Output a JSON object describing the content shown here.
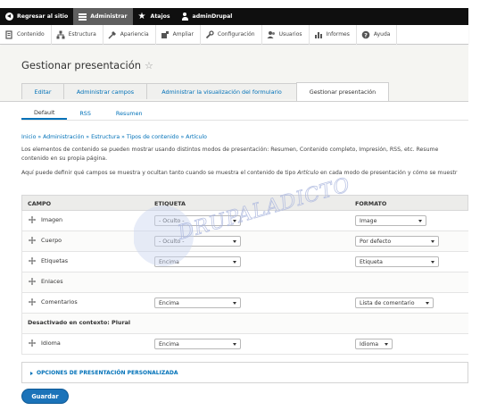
{
  "toolbar": {
    "items": [
      {
        "label": "Regresar al sitio",
        "icon": "back-arrow-icon"
      },
      {
        "label": "Administrar",
        "icon": "menu-icon"
      },
      {
        "label": "Atajos",
        "icon": "star-icon"
      },
      {
        "label": "adminDrupal",
        "icon": "user-icon"
      }
    ]
  },
  "admin_menu": {
    "items": [
      {
        "label": "Contenido",
        "icon": "content-icon"
      },
      {
        "label": "Estructura",
        "icon": "structure-icon"
      },
      {
        "label": "Apariencia",
        "icon": "appearance-icon"
      },
      {
        "label": "Ampliar",
        "icon": "extend-icon"
      },
      {
        "label": "Configuración",
        "icon": "wrench-icon"
      },
      {
        "label": "Usuarios",
        "icon": "users-icon"
      },
      {
        "label": "Informes",
        "icon": "reports-icon"
      },
      {
        "label": "Ayuda",
        "icon": "help-icon"
      }
    ]
  },
  "page": {
    "title": "Gestionar presentación",
    "title_icon": "star-outline-icon",
    "tabs": [
      {
        "label": "Editar"
      },
      {
        "label": "Administrar campos"
      },
      {
        "label": "Administrar la visualización del formulario"
      },
      {
        "label": "Gestionar presentación"
      }
    ],
    "subtabs": [
      {
        "label": "Default"
      },
      {
        "label": "RSS"
      },
      {
        "label": "Resumen"
      }
    ],
    "breadcrumb": "Inicio » Administración » Estructura » Tipos de contenido » Artículo",
    "description_1": "Los elementos de contenido se pueden mostrar usando distintos modos de presentación: Resumen, Contenido completo, Impresión, RSS, etc. Resume",
    "description_2": "contenido en su propia página.",
    "description_3_a": "Aquí puede definir qué campos se muestra y ocultan tanto cuando se muestra el contenido de tipo ",
    "description_3_em": "Artículo",
    "description_3_b": " en cada modo de presentación y cómo se muestr"
  },
  "table": {
    "headers": {
      "field": "CAMPO",
      "label": "ETIQUETA",
      "format": "FORMATO"
    },
    "rows": [
      {
        "name": "Imagen",
        "label": "- Oculto -",
        "format": "Image"
      },
      {
        "name": "Cuerpo",
        "label": "- Oculto -",
        "format": "Por defecto"
      },
      {
        "name": "Etiquetas",
        "label": "Encima",
        "format": "Etiqueta"
      },
      {
        "name": "Enlaces"
      },
      {
        "name": "Comentarios",
        "label": "Encima",
        "format": "Lista de comentario"
      }
    ],
    "region_disabled": "Desactivado en contexto: Plural",
    "disabled_rows": [
      {
        "name": "Idioma",
        "label": "Encima",
        "format": "Idioma"
      }
    ]
  },
  "custom_display": {
    "label": "OPCIONES DE PRESENTACIÓN PERSONALIZADA"
  },
  "save_button": {
    "label": "Guardar"
  },
  "watermark": {
    "text": "DRUPALADICTO"
  },
  "colors": {
    "link": "#0071b8",
    "toolbar": "#0f0f0f",
    "primary_button": "#1b73b9"
  }
}
